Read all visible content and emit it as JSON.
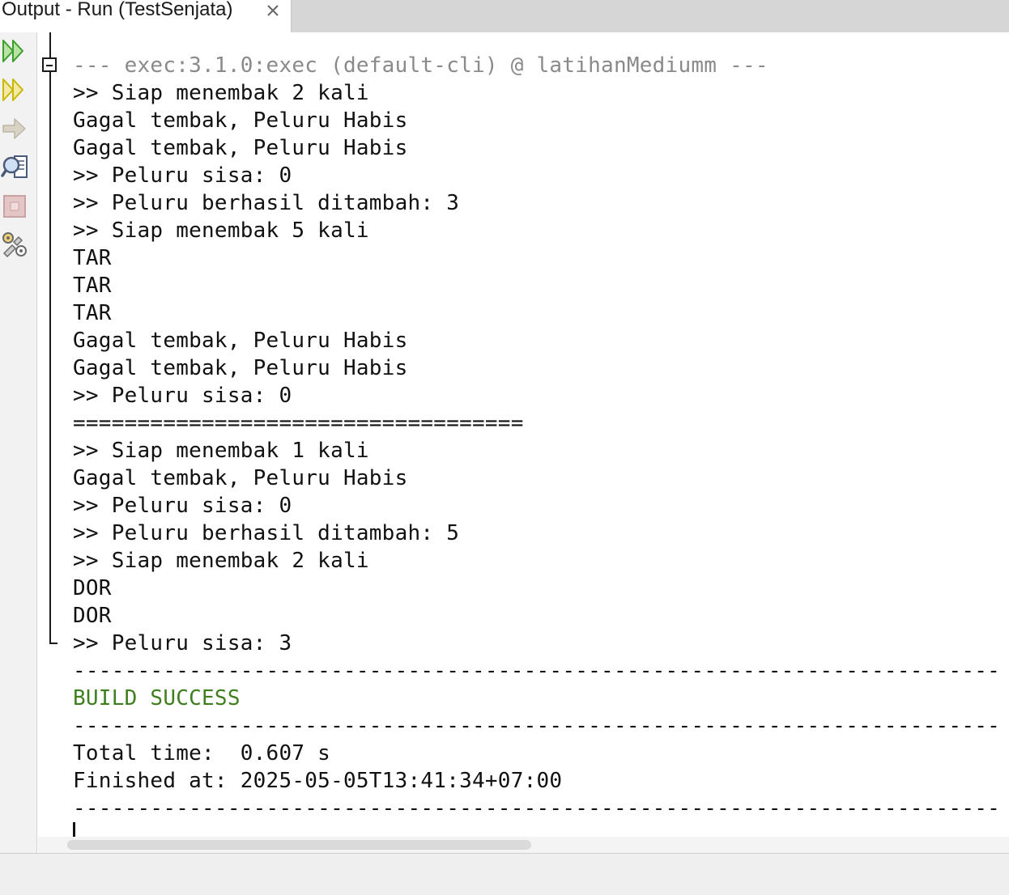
{
  "tab": {
    "title": "Output - Run (TestSenjata)",
    "close_icon": "close-icon"
  },
  "actions": [
    {
      "name": "rerun-icon",
      "color": "#3aa02a"
    },
    {
      "name": "rerun-with-options-icon",
      "color": "#c9b800"
    },
    {
      "name": "stop-arrow-icon",
      "color": "#bdb6a6"
    },
    {
      "name": "inspect-icon",
      "color": "#4a5a78"
    },
    {
      "name": "stop-icon",
      "color": "#c9a3a3"
    },
    {
      "name": "settings-icon",
      "color": "#6b6b6b"
    }
  ],
  "console": {
    "lines": [
      "--- exec:3.1.0:exec (default-cli) @ latihanMediumm ---",
      ">> Siap menembak 2 kali",
      "Gagal tembak, Peluru Habis",
      "Gagal tembak, Peluru Habis",
      ">> Peluru sisa: 0",
      ">> Peluru berhasil ditambah: 3",
      ">> Siap menembak 5 kali",
      "TAR",
      "TAR",
      "TAR",
      "Gagal tembak, Peluru Habis",
      "Gagal tembak, Peluru Habis",
      ">> Peluru sisa: 0",
      "===================================",
      ">> Siap menembak 1 kali",
      "Gagal tembak, Peluru Habis",
      ">> Peluru sisa: 0",
      ">> Peluru berhasil ditambah: 5",
      ">> Siap menembak 2 kali",
      "DOR",
      "DOR",
      ">> Peluru sisa: 3",
      "------------------------------------------------------------------------",
      "BUILD SUCCESS",
      "------------------------------------------------------------------------",
      "Total time:  0.607 s",
      "Finished at: 2025-05-05T13:41:34+07:00",
      "------------------------------------------------------------------------"
    ]
  },
  "colors": {
    "exec_line": "#8a8a8a",
    "build_success": "#3f7f1f",
    "text": "#111111"
  }
}
